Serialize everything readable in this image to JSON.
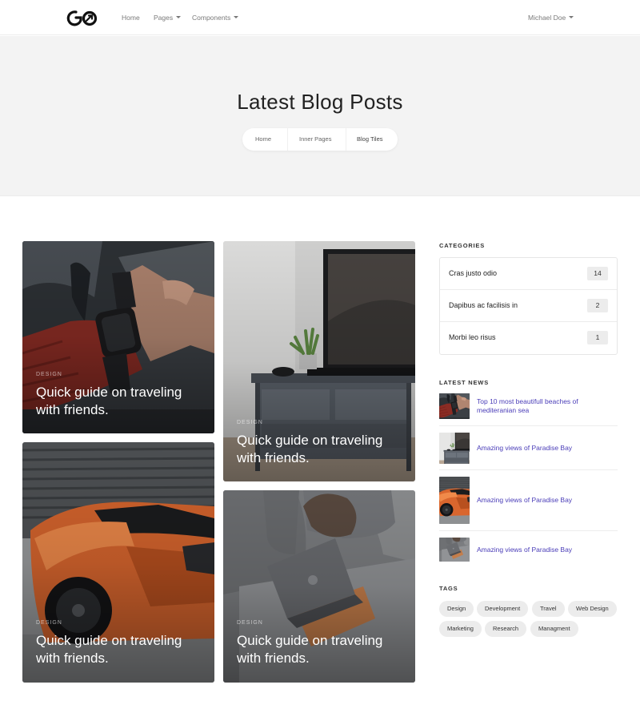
{
  "nav": {
    "logo_text": "GO",
    "links": [
      "Home",
      "Pages",
      "Components"
    ],
    "user": "Michael Doe"
  },
  "hero": {
    "title": "Latest Blog Posts",
    "breadcrumb": [
      "Home",
      "Inner Pages",
      "Blog Tiles"
    ]
  },
  "posts": [
    {
      "category": "DESIGN",
      "title": "Quick guide on traveling with friends.",
      "image": "smartwatch-wrist"
    },
    {
      "category": "DESIGN",
      "title": "Quick guide on traveling with friends.",
      "image": "tv-stand-living-room"
    },
    {
      "category": "DESIGN",
      "title": "Quick guide on traveling with friends.",
      "image": "orange-sports-car"
    },
    {
      "category": "DESIGN",
      "title": "Quick guide on traveling with friends.",
      "image": "laptop-on-sofa"
    }
  ],
  "sidebar": {
    "categories_heading": "CATEGORIES",
    "categories": [
      {
        "label": "Cras justo odio",
        "count": "14"
      },
      {
        "label": "Dapibus ac facilisis in",
        "count": "2"
      },
      {
        "label": "Morbi leo risus",
        "count": "1"
      }
    ],
    "news_heading": "LATEST NEWS",
    "news": [
      {
        "title": "Top 10 most beautifull beaches of mediteranian sea",
        "image": "smartwatch-wrist"
      },
      {
        "title": "Amazing views of Paradise Bay",
        "image": "tv-stand-living-room"
      },
      {
        "title": "Amazing views of Paradise Bay",
        "image": "orange-sports-car"
      },
      {
        "title": "Amazing views of Paradise Bay",
        "image": "laptop-on-sofa"
      }
    ],
    "tags_heading": "TAGS",
    "tags": [
      "Design",
      "Development",
      "Travel",
      "Web Design",
      "Marketing",
      "Research",
      "Managment"
    ]
  },
  "colors": {
    "link": "#4a3db8",
    "hero_bg": "#f3f3f3",
    "badge_bg": "#ececec"
  }
}
